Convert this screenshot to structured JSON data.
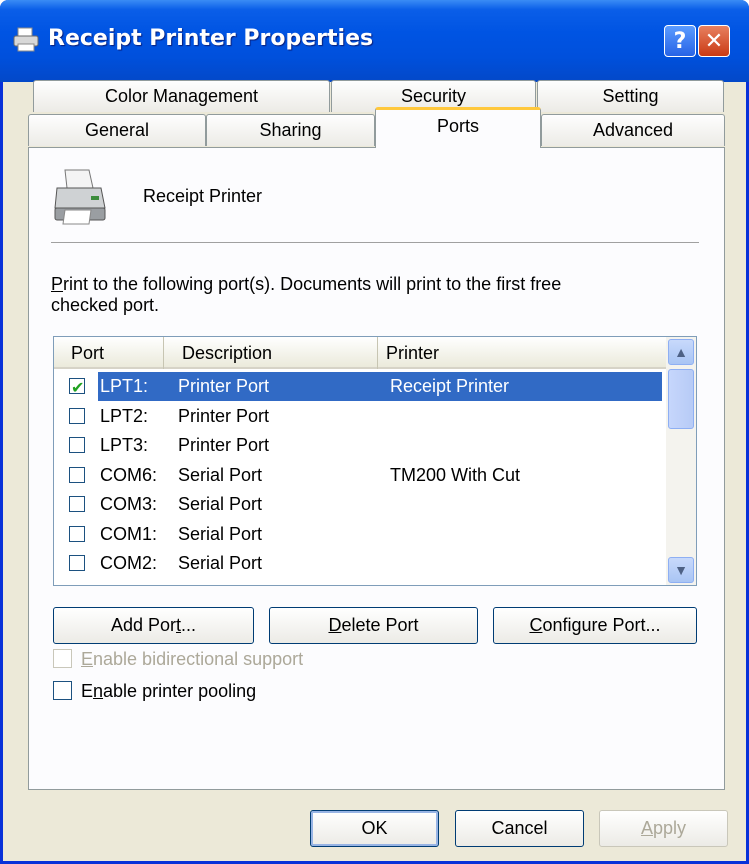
{
  "window": {
    "title": "Receipt Printer Properties",
    "help_button": "?",
    "close_button": "✕"
  },
  "tabs": {
    "row1": [
      "Color Management",
      "Security",
      "Setting"
    ],
    "row2": [
      "General",
      "Sharing",
      "Ports",
      "Advanced"
    ],
    "active": "Ports"
  },
  "printer": {
    "name": "Receipt Printer"
  },
  "instructions": {
    "first_letter": "P",
    "line1_rest": "rint to the following port(s). Documents will print to the first free",
    "line2": "checked port."
  },
  "port_list": {
    "headers": [
      "Port",
      "Description",
      "Printer"
    ],
    "rows": [
      {
        "port": "LPT1:",
        "description": "Printer Port",
        "printer": "Receipt Printer",
        "checked": true,
        "selected": true
      },
      {
        "port": "LPT2:",
        "description": "Printer Port",
        "printer": "",
        "checked": false,
        "selected": false
      },
      {
        "port": "LPT3:",
        "description": "Printer Port",
        "printer": "",
        "checked": false,
        "selected": false
      },
      {
        "port": "COM6:",
        "description": "Serial Port",
        "printer": "TM200 With Cut",
        "checked": false,
        "selected": false
      },
      {
        "port": "COM3:",
        "description": "Serial Port",
        "printer": "",
        "checked": false,
        "selected": false
      },
      {
        "port": "COM1:",
        "description": "Serial Port",
        "printer": "",
        "checked": false,
        "selected": false
      },
      {
        "port": "COM2:",
        "description": "Serial Port",
        "printer": "",
        "checked": false,
        "selected": false
      }
    ]
  },
  "port_buttons": {
    "add": {
      "pre": "Add Por",
      "key": "t",
      "post": "..."
    },
    "delete": {
      "pre": "",
      "key": "D",
      "post": "elete Port"
    },
    "configure": {
      "pre": "",
      "key": "C",
      "post": "onfigure Port..."
    }
  },
  "options": {
    "bidirectional": {
      "key": "E",
      "rest": "nable bidirectional support",
      "checked": false,
      "enabled": false
    },
    "pooling": {
      "key": "n",
      "pre": "E",
      "rest": "able printer pooling",
      "checked": false,
      "enabled": true
    }
  },
  "dialog_buttons": {
    "ok": "OK",
    "cancel": "Cancel",
    "apply_key": "A",
    "apply_rest": "pply"
  },
  "colors": {
    "titlebar": "#0054e3",
    "selection": "#316ac5",
    "active_tab_accent": "#ffc83c",
    "dialog_bg": "#ece9d8"
  }
}
